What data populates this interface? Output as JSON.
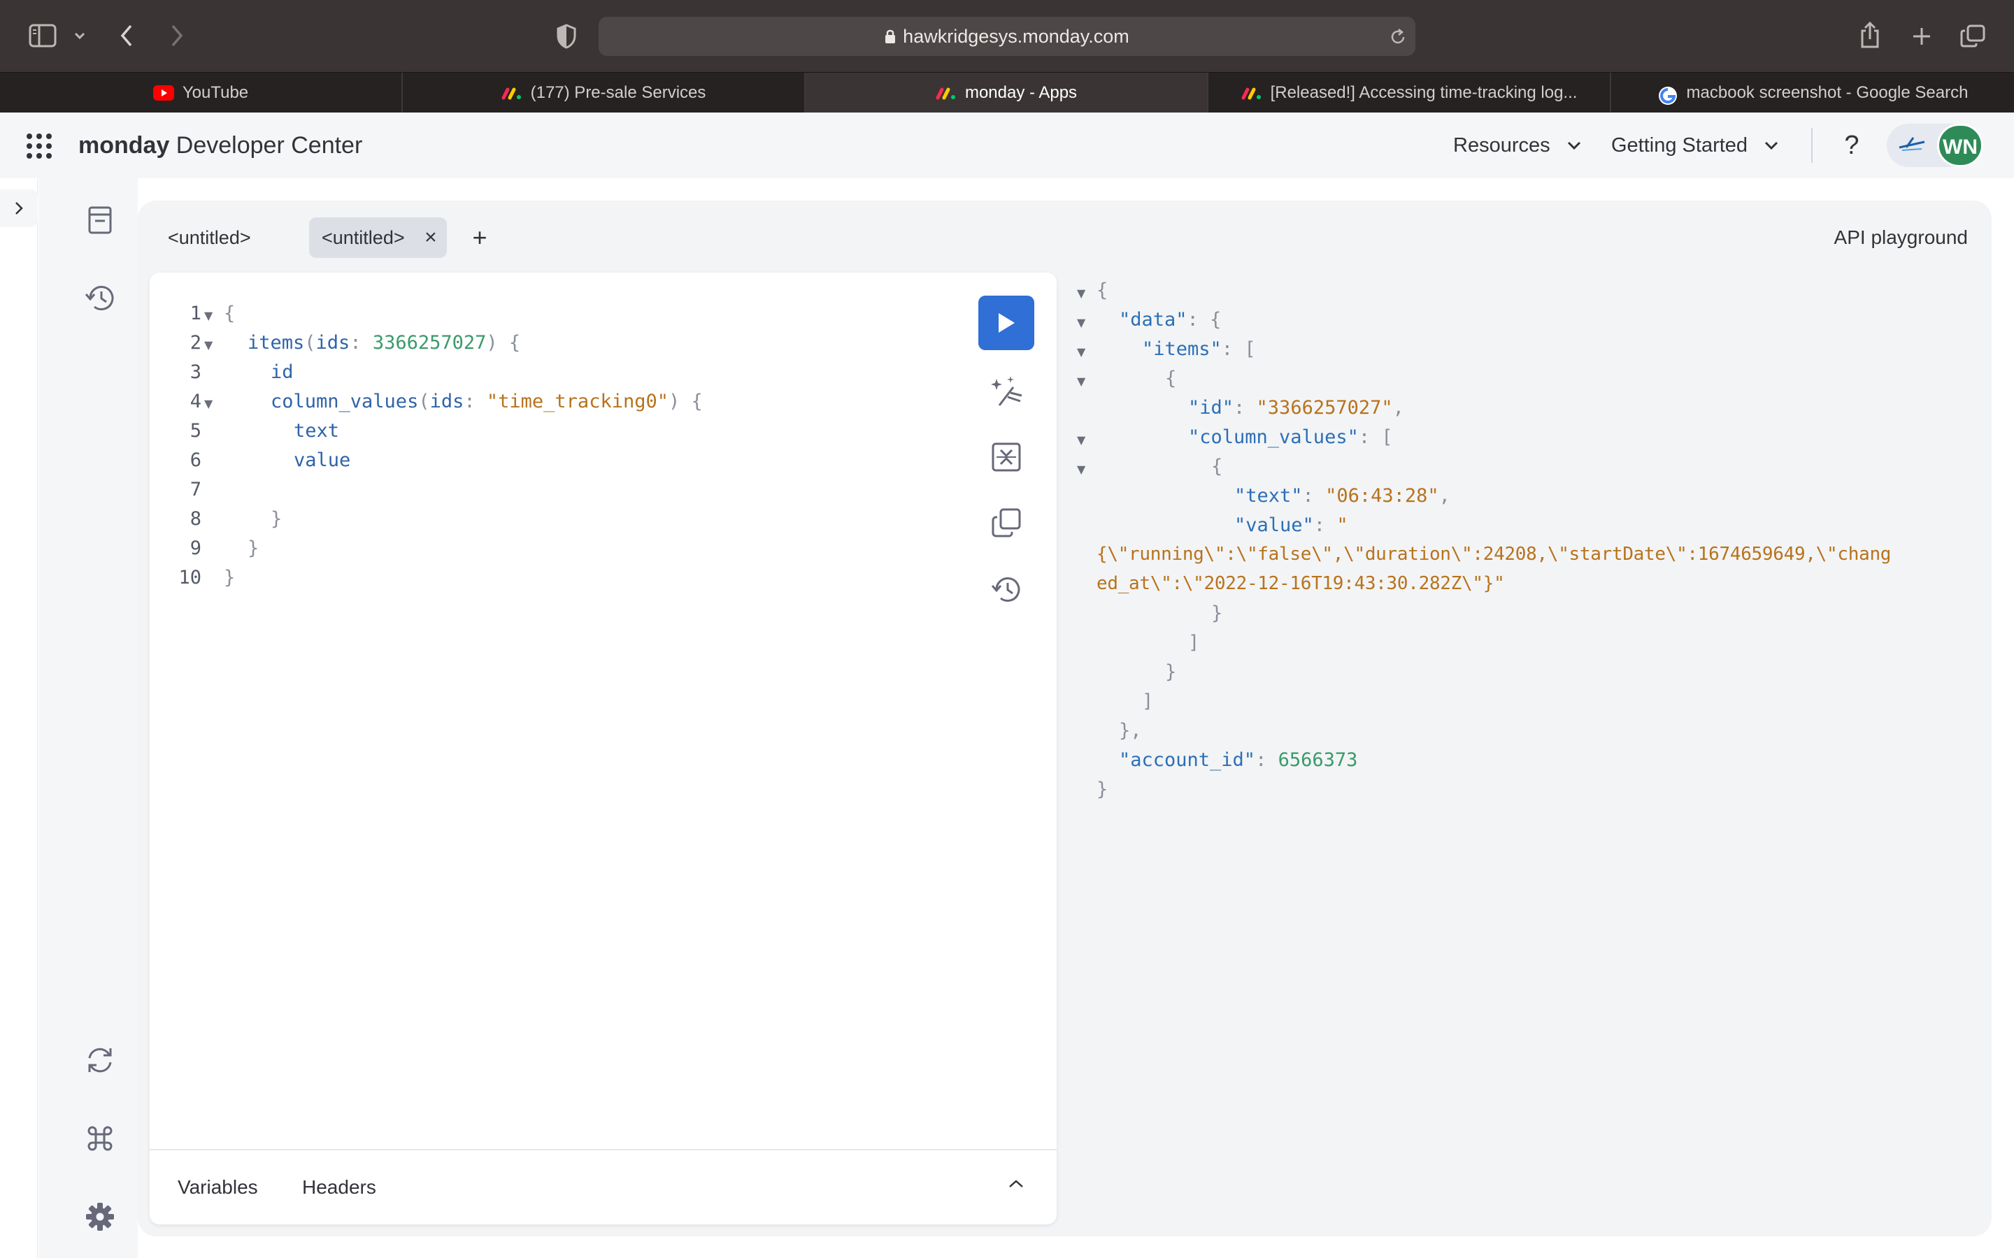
{
  "browser": {
    "url": "hawkridgesys.monday.com",
    "tabs": [
      {
        "label": "YouTube",
        "favicon": "youtube-icon"
      },
      {
        "label": "(177) Pre-sale Services",
        "favicon": "monday-icon"
      },
      {
        "label": "monday - Apps",
        "favicon": "monday-icon",
        "active": true
      },
      {
        "label": "[Released!] Accessing time-tracking log...",
        "favicon": "monday-icon"
      },
      {
        "label": "macbook screenshot - Google Search",
        "favicon": "google-icon"
      }
    ]
  },
  "header": {
    "brand_bold": "monday",
    "brand_rest": " Developer Center",
    "menu_resources": "Resources",
    "menu_getting_started": "Getting Started",
    "help": "?",
    "avatar_initials": "WN",
    "avatar_color": "#2e8b57"
  },
  "playground": {
    "tabs": [
      "<untitled>",
      "<untitled>"
    ],
    "close": "×",
    "add": "+",
    "title": "API playground",
    "bottom_tabs": {
      "variables": "Variables",
      "headers": "Headers"
    }
  },
  "query": {
    "line_numbers": [
      "1",
      "2",
      "3",
      "4",
      "5",
      "6",
      "7",
      "8",
      "9",
      "10"
    ],
    "l1": "{",
    "l2_fn": "items",
    "l2_open": "(",
    "l2_arg": "ids",
    "l2_colon": ": ",
    "l2_num": "3366257027",
    "l2_close": ") {",
    "l3": "id",
    "l4_fn": "column_values",
    "l4_open": "(",
    "l4_arg": "ids",
    "l4_colon": ": ",
    "l4_str": "\"time_tracking0\"",
    "l4_close": ") {",
    "l5": "text",
    "l6": "value",
    "l8": "}",
    "l9": "}",
    "l10": "}"
  },
  "response": {
    "open": "{",
    "data_key": "\"data\"",
    "colon": ": ",
    "brace_open": "{",
    "items_key": "\"items\"",
    "bracket_open": "[",
    "id_key": "\"id\"",
    "id_val": "\"3366257027\"",
    "comma": ",",
    "cv_key": "\"column_values\"",
    "text_key": "\"text\"",
    "text_val": "\"06:43:28\"",
    "value_key": "\"value\"",
    "value_val_1": "\"",
    "value_val_2": "{\\\"running\\\":\\\"false\\\",\\\"duration\\\":24208,\\\"startDate\\\":1674659649,\\\"chang",
    "value_val_3": "ed_at\\\":\\\"2022-12-16T19:43:30.282Z\\\"}\"",
    "brace_close": "}",
    "bracket_close": "]",
    "brace_close_comma": "},",
    "account_key": "\"account_id\"",
    "account_val": "6566373",
    "close": "}"
  }
}
